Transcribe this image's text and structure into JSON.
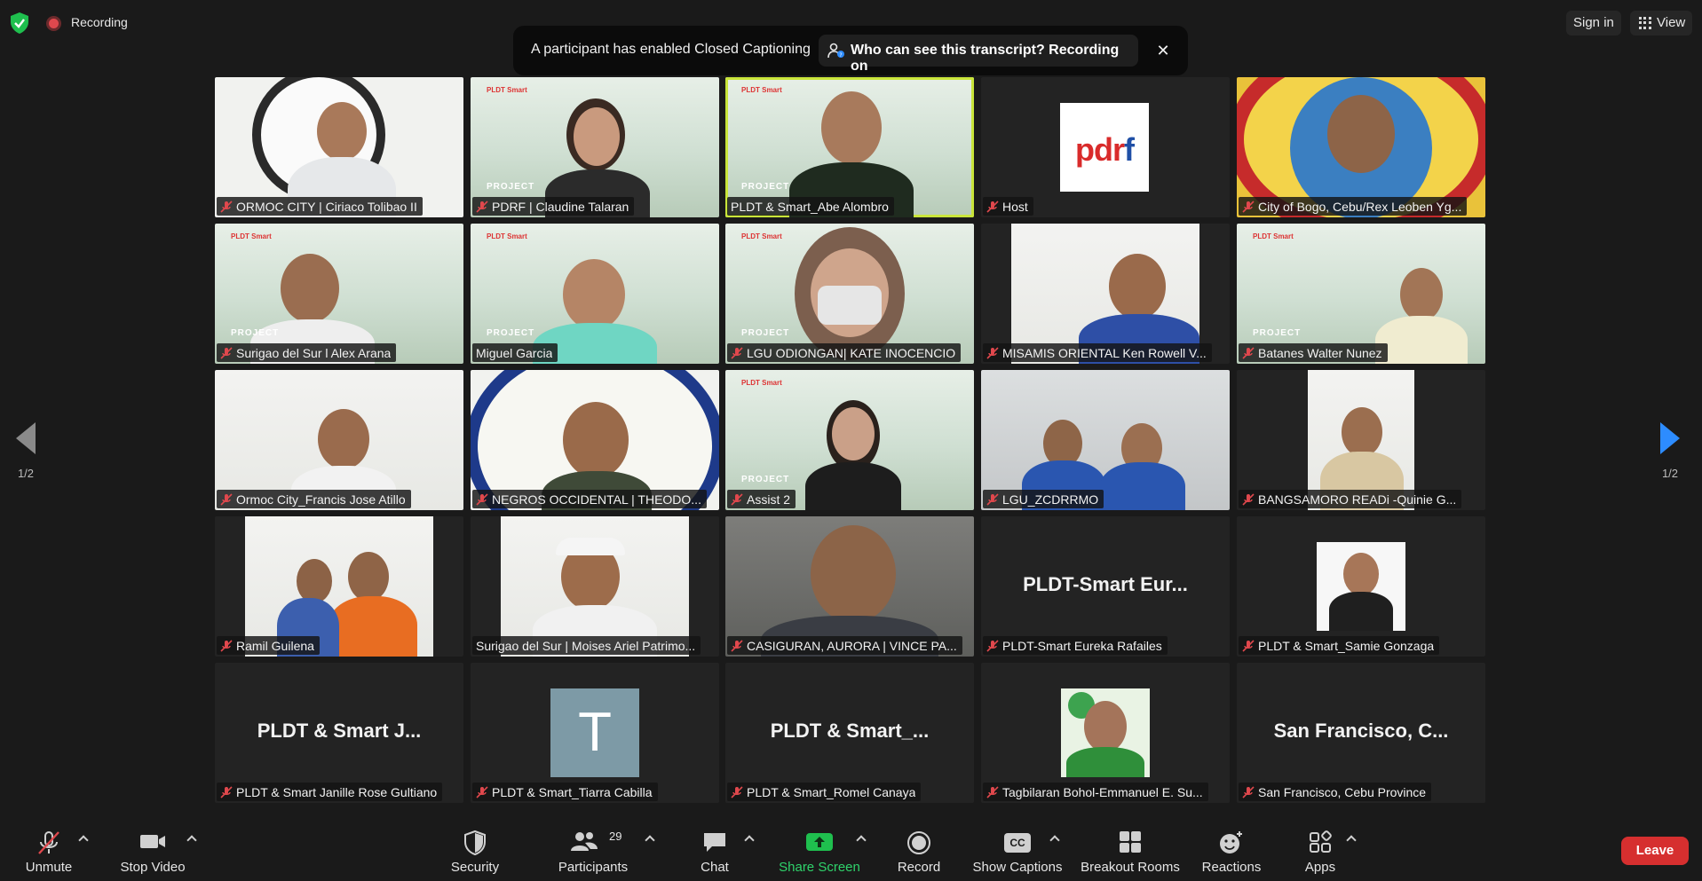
{
  "top": {
    "recording_label": "Recording",
    "sign_in": "Sign in",
    "view": "View"
  },
  "notice": {
    "text": "A participant has enabled Closed Captioning",
    "pill": "Who can see this transcript? Recording on",
    "close": "✕"
  },
  "tiles": [
    "ORMOC CITY | Ciriaco Tolibao II",
    "PDRF | Claudine Talaran",
    "PLDT & Smart_Abe Alombro",
    "Host",
    "City of Bogo, Cebu/Rex Leoben Yg...",
    "Surigao del Sur l Alex Arana",
    "Miguel Garcia",
    "LGU ODIONGAN| KATE INOCENCIO",
    "MISAMIS ORIENTAL Ken Rowell V...",
    "Batanes Walter Nunez",
    "Ormoc City_Francis Jose Atillo",
    "NEGROS OCCIDENTAL | THEODO...",
    "Assist 2",
    "LGU_ZCDRRMO",
    "BANGSAMORO  READi -Quinie  G...",
    "Ramil Guilena",
    "Surigao del Sur | Moises Ariel Patrimo...",
    "CASIGURAN, AURORA | VINCE PA...",
    "PLDT-Smart Eureka Rafailes",
    "PLDT & Smart_Samie Gonzaga",
    "PLDT & Smart Janille Rose Gultiano",
    "PLDT & Smart_Tiarra Cabilla",
    "PLDT & Smart_Romel Canaya",
    "Tagbilaran Bohol-Emmanuel E. Su...",
    "San Francisco, Cebu Province"
  ],
  "big_names": {
    "eureka": "PLDT-Smart Eur...",
    "janille": "PLDT & Smart J...",
    "romel": "PLDT & Smart_...",
    "sanfrancisco": "San Francisco, C..."
  },
  "avatars": {
    "pdrf_logo_text": "pdr",
    "pdrf_logo_f": "f",
    "t_initial": "T",
    "project_tag": "PROJECT",
    "brand_strip": "PLDT  Smart"
  },
  "pager": {
    "left": "1/2",
    "right": "1/2"
  },
  "toolbar": {
    "unmute": "Unmute",
    "stop_video": "Stop Video",
    "security": "Security",
    "participants": "Participants",
    "participants_count": "29",
    "chat": "Chat",
    "share_screen": "Share Screen",
    "record": "Record",
    "show_captions": "Show Captions",
    "breakout_rooms": "Breakout Rooms",
    "reactions": "Reactions",
    "apps": "Apps",
    "leave": "Leave",
    "cc_icon_text": "CC"
  },
  "colors": {
    "accent_blue": "#2d8cff",
    "share_green": "#2fd36b",
    "leave_red": "#d62f2f",
    "active_speaker": "#c9e53a",
    "mute_red": "#e0484d"
  }
}
